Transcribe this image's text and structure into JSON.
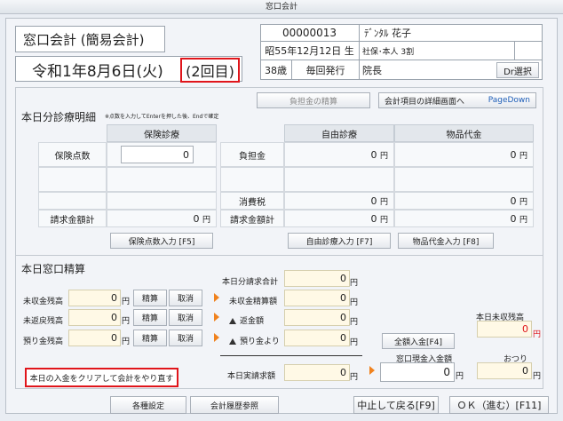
{
  "window": {
    "title": "窓口会計"
  },
  "header": {
    "mode_title": "窓口会計 (簡易会計)",
    "date": "令和1年8月6日(火)",
    "visit_count": "(2回目)",
    "patient_id": "00000013",
    "patient_name": "ﾃﾞﾝﾀﾙ 花子",
    "birth": "昭55年12月12日 生",
    "insurance": "社保･本人 3割",
    "age": "38歳",
    "issue": "毎回発行",
    "dept": "院長",
    "dr_select": "Dr選択"
  },
  "top_buttons": {
    "burden_calc": "負担金の精算",
    "detail_screen": "会計項目の詳細画面へ",
    "pagedown": "PageDown"
  },
  "statement": {
    "title": "本日分診療明細",
    "note": "※点数を入力してEnterを押した後、Endで確定",
    "col_insurance": "保険診療",
    "col_self": "自由診療",
    "col_goods": "物品代金",
    "row_points": "保険点数",
    "points_value": "0",
    "row_burden": "負担金",
    "row_tax": "消費税",
    "row_bill_left": "請求金額計",
    "row_bill_right": "請求金額計",
    "bill_value": "0",
    "yen": "円",
    "self_burden": "0",
    "goods_burden": "0",
    "self_tax": "0",
    "goods_tax": "0",
    "self_bill": "0",
    "goods_bill": "0",
    "btn_points": "保険点数入力 [F5]",
    "btn_self": "自由診療入力 [F7]",
    "btn_goods": "物品代金入力 [F8]"
  },
  "settlement": {
    "title": "本日窓口精算",
    "rows": [
      {
        "label": "未収金残高",
        "value": "0",
        "settle": "精算",
        "cancel": "取消"
      },
      {
        "label": "未返戻残高",
        "value": "0",
        "settle": "精算",
        "cancel": "取消"
      },
      {
        "label": "預り金残高",
        "value": "0",
        "settle": "精算",
        "cancel": "取消"
      }
    ],
    "today_bill_label": "本日分請求合計",
    "today_bill": "0",
    "uncollected_label": "未収金精算額",
    "uncollected": "0",
    "refund_label": "返金額",
    "refund": "0",
    "deposit_label": "預り金より",
    "deposit": "0",
    "actual_label": "本日実請求額",
    "actual": "0",
    "full_pay_btn": "全額入金[F4]",
    "cash_label": "窓口現金入金額",
    "cash": "0",
    "change_label": "おつり",
    "change": "0",
    "unpaid_label": "本日未収残高",
    "unpaid": "0",
    "yen": "円",
    "clear_btn": "本日の入金をクリアして会計をやり直す"
  },
  "footer": {
    "settings": "各種設定",
    "history": "会計履歴参照",
    "back": "中止して戻る[F9]",
    "ok": "ＯＫ（進む）[F11]"
  },
  "colors": {
    "accent_red": "#e0151b",
    "arrow_orange": "#f0821e",
    "yellow_field": "#fff9e6"
  }
}
